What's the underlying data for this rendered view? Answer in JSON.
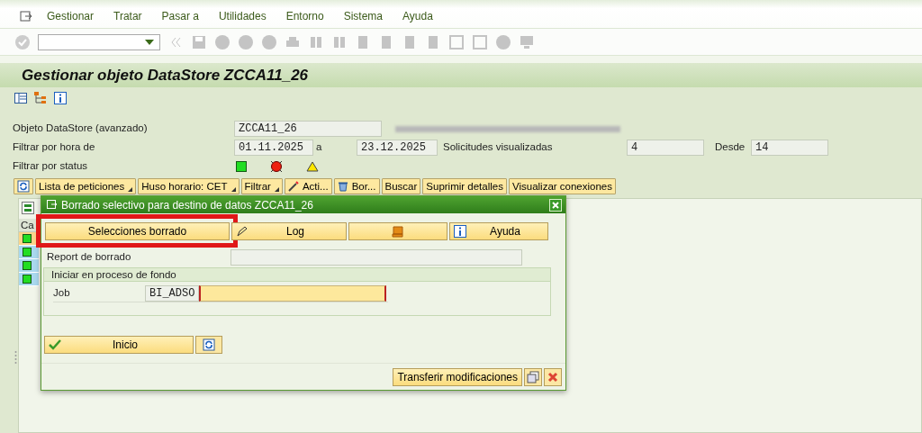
{
  "menu": [
    "Gestionar",
    "Tratar",
    "Pasar a",
    "Utilidades",
    "Entorno",
    "Sistema",
    "Ayuda"
  ],
  "title": "Gestionar objeto DataStore ZCCA11_26",
  "fields": [
    {
      "kind": "single",
      "label": "Objeto DataStore (avanzado)",
      "value": "ZCCA11_26"
    },
    {
      "kind": "range",
      "label": "Filtrar por hora de",
      "value": "01.11.2025",
      "joiner": "a",
      "value_to": "23.12.2025",
      "label2": "Solicitudes visualizadas",
      "value2": "4",
      "label3": "Desde",
      "value3": "14"
    },
    {
      "kind": "status",
      "label": "Filtrar por status",
      "statuses": [
        {
          "kind": "success"
        },
        {
          "kind": "error"
        },
        {
          "kind": "warning"
        }
      ]
    }
  ],
  "toolbar": [
    {
      "kind": "icon"
    },
    {
      "kind": "text",
      "label": "Lista de peticiones",
      "menu": true
    },
    {
      "kind": "text",
      "label": "Huso horario: CET",
      "menu": true
    },
    {
      "kind": "text",
      "label": "Filtrar",
      "menu": true
    },
    {
      "kind": "text",
      "label": "Acti...",
      "menu": false
    },
    {
      "kind": "text",
      "label": "Bor...",
      "menu": false
    },
    {
      "kind": "text",
      "label": "Buscar",
      "menu": false
    },
    {
      "kind": "text",
      "label": "Suprimir detalles",
      "menu": false
    },
    {
      "kind": "text",
      "label": "Visualizar conexiones",
      "menu": false
    }
  ],
  "table": {
    "column_1": "Ca",
    "rows": [
      {
        "selected": true
      },
      {
        "selected": false
      },
      {
        "selected": false
      },
      {
        "selected": false
      }
    ]
  },
  "dialog": {
    "title": "Borrado selectivo para destino de datos ZCCA11_26",
    "buttons": [
      {
        "label": "Selecciones borrado",
        "highlighted": true
      },
      {
        "label": "Log",
        "highlighted": false
      },
      {
        "highlighted": false
      },
      {
        "label": "Ayuda",
        "highlighted": false
      }
    ],
    "report_label": "Report de borrado",
    "group_title": "Iniciar en proceso de fondo",
    "job_label": "Job",
    "job_prefix": "BI_ADSO",
    "start_button": "Inicio",
    "transfer_button": "Transferir modificaciones"
  }
}
